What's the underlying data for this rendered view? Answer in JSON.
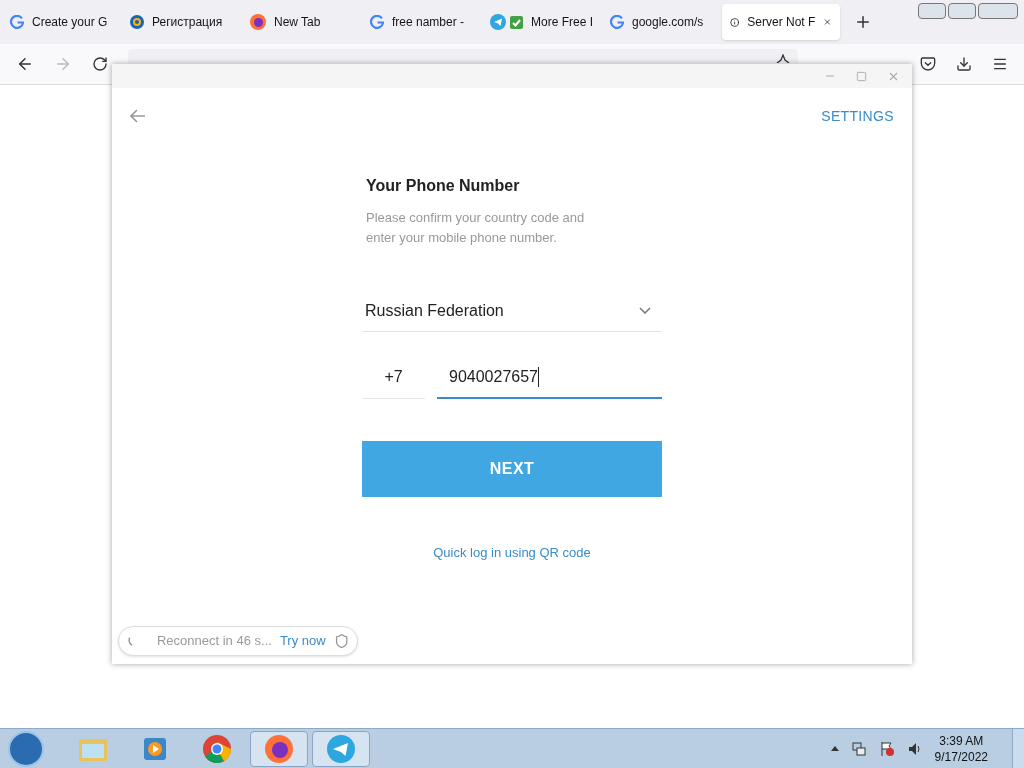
{
  "browser": {
    "tabs": [
      {
        "label": "Create your G",
        "kind": "google",
        "selected": false
      },
      {
        "label": "Регистрация",
        "kind": "mail",
        "selected": false
      },
      {
        "label": "New Tab",
        "kind": "firefox",
        "selected": false
      },
      {
        "label": "free namber -",
        "kind": "google",
        "selected": false
      },
      {
        "label": "More Free I",
        "kind": "telegram",
        "selected": false
      },
      {
        "label": "google.com/s",
        "kind": "google",
        "selected": false
      },
      {
        "label": "Server Not F",
        "kind": "info",
        "selected": true
      }
    ]
  },
  "app": {
    "settings": "SETTINGS",
    "title": "Your Phone Number",
    "subtitle": "Please confirm your country code and enter your mobile phone number.",
    "country": "Russian Federation",
    "code": "+7",
    "phone": "9040027657",
    "next": "NEXT",
    "qr_link": "Quick log in using QR code",
    "status": {
      "text": "Reconnect in 46 s...",
      "action": "Try now"
    }
  },
  "taskbar": {
    "apps": [
      {
        "kind": "folder",
        "selected": false
      },
      {
        "kind": "media",
        "selected": false
      },
      {
        "kind": "chrome",
        "selected": false
      },
      {
        "kind": "firefox",
        "selected": true
      },
      {
        "kind": "telegram",
        "selected": true
      }
    ],
    "time": "3:39 AM",
    "date": "9/17/2022"
  }
}
